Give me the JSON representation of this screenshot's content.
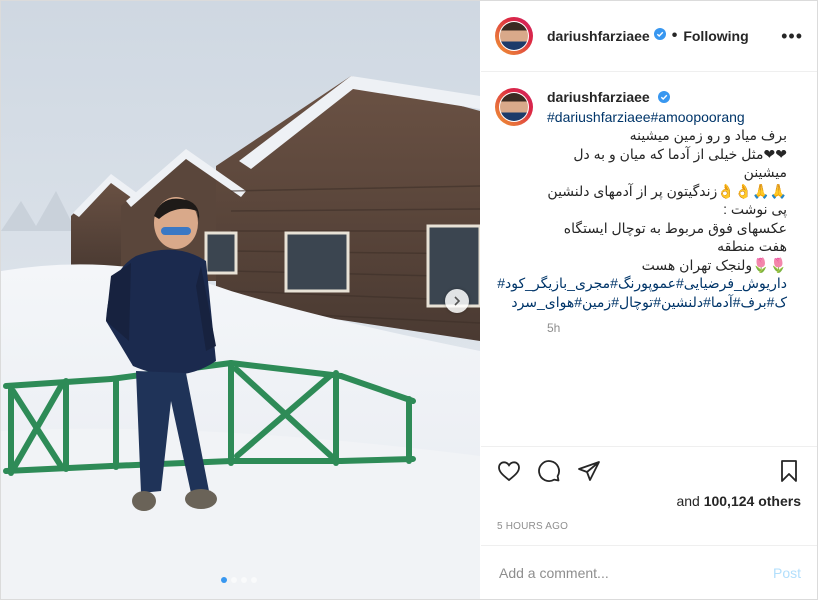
{
  "post": {
    "username": "dariushfarziaee",
    "follow_status": "Following",
    "more_label": "•••",
    "caption": {
      "username": "dariushfarziaee",
      "hashtags": "#dariushfarziaee#amoopoorang",
      "lines": [
        "برف میاد و رو زمین میشینه",
        "❤❤مثل خیلی از آدما که میان و به دل میشینن",
        "🙏🙏👌👌زندگیتون پر از آدمهای دلنشین",
        "پی نوشت :",
        "عکسهای فوق مربوط به توچال ایستگاه هفت منطقه",
        "🌷🌷ولنجک تهران هست",
        "داریوش_فرضیایی#عموپورنگ#مجری_بازیگر_کود#",
        "ک#برف#آدما#دلنشین#توچال#زمین#هوای_سرد"
      ],
      "time": "5h"
    },
    "likes_prefix": "and ",
    "likes_count": "100,124",
    "likes_suffix": " others",
    "posted_ago": "5 HOURS AGO",
    "comment_placeholder": "Add a comment...",
    "post_label": "Post",
    "carousel": {
      "count": 4,
      "active": 0
    }
  },
  "colors": {
    "link": "#003569",
    "verified": "#3897f0",
    "post_button": "#b2dffc",
    "secondary_text": "#8e8e8e"
  },
  "icons": [
    "verified-badge-icon",
    "heart-icon",
    "comment-icon",
    "share-icon",
    "bookmark-icon",
    "chevron-right-icon"
  ]
}
